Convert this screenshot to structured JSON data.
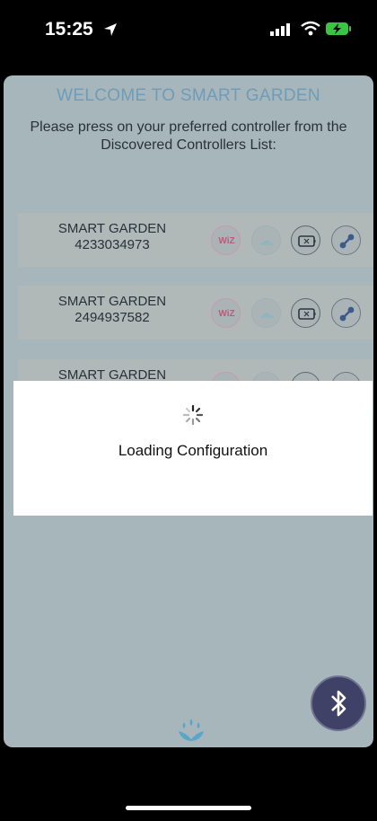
{
  "status_bar": {
    "time": "15:25",
    "location_icon": "location-arrow-icon",
    "signal_icon": "cellular-signal-icon",
    "wifi_icon": "wifi-icon",
    "battery_icon": "battery-charging-icon"
  },
  "header": {
    "title": "WELCOME TO SMART GARDEN",
    "instructions": "Please press on your preferred controller from the Discovered Controllers List:"
  },
  "controllers": [
    {
      "name": "SMART GARDEN",
      "serial": "4233034973",
      "wiz_label": "WiZ"
    },
    {
      "name": "SMART GARDEN",
      "serial": "2494937582",
      "wiz_label": "WiZ"
    },
    {
      "name": "SMART GARDEN",
      "serial": "",
      "wiz_label": ""
    }
  ],
  "loading": {
    "message": "Loading Configuration",
    "icon": "spinner-icon"
  },
  "footer": {
    "bluetooth_icon": "bluetooth-icon",
    "logo_icon": "water-lotus-logo-icon"
  },
  "colors": {
    "title": "#6e9cb9",
    "wiz": "#c05a7a",
    "bluetooth_button": "#3f4266",
    "logo": "#5aa6c8"
  }
}
